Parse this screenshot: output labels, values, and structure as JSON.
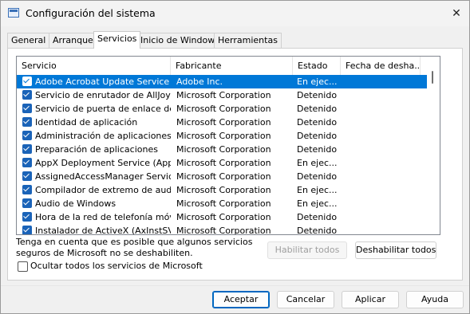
{
  "window": {
    "title": "Configuración del sistema",
    "close_glyph": "✕",
    "icon": "msconfig-icon"
  },
  "tabs": [
    {
      "label": "General"
    },
    {
      "label": "Arranque"
    },
    {
      "label": "Servicios",
      "active": true
    },
    {
      "label": "Inicio de Windows"
    },
    {
      "label": "Herramientas"
    }
  ],
  "services": {
    "columns": [
      "Servicio",
      "Fabricante",
      "Estado",
      "Fecha de desha..."
    ],
    "rows": [
      {
        "name": "Adobe Acrobat Update Service",
        "maker": "Adobe Inc.",
        "status": "En ejec...",
        "checked": true,
        "selected": true
      },
      {
        "name": "Servicio de enrutador de AllJoyn",
        "maker": "Microsoft Corporation",
        "status": "Detenido",
        "checked": true
      },
      {
        "name": "Servicio de puerta de enlace de ...",
        "maker": "Microsoft Corporation",
        "status": "Detenido",
        "checked": true
      },
      {
        "name": "Identidad de aplicación",
        "maker": "Microsoft Corporation",
        "status": "Detenido",
        "checked": true
      },
      {
        "name": "Administración de aplicaciones",
        "maker": "Microsoft Corporation",
        "status": "Detenido",
        "checked": true
      },
      {
        "name": "Preparación de aplicaciones",
        "maker": "Microsoft Corporation",
        "status": "Detenido",
        "checked": true
      },
      {
        "name": "AppX Deployment Service (AppX...",
        "maker": "Microsoft Corporation",
        "status": "En ejec...",
        "checked": true
      },
      {
        "name": "AssignedAccessManager Service",
        "maker": "Microsoft Corporation",
        "status": "Detenido",
        "checked": true
      },
      {
        "name": "Compilador de extremo de audio...",
        "maker": "Microsoft Corporation",
        "status": "En ejec...",
        "checked": true
      },
      {
        "name": "Audio de Windows",
        "maker": "Microsoft Corporation",
        "status": "En ejec...",
        "checked": true
      },
      {
        "name": "Hora de la red de telefonía móvil",
        "maker": "Microsoft Corporation",
        "status": "Detenido",
        "checked": true
      },
      {
        "name": "Instalador de ActiveX (AxInstSV)",
        "maker": "Microsoft Corporation",
        "status": "Detenido",
        "checked": true
      }
    ]
  },
  "note": "Tenga en cuenta que es posible que algunos servicios seguros de Microsoft no se deshabiliten.",
  "buttons": {
    "enable_all": "Habilitar todos",
    "disable_all": "Deshabilitar todos",
    "ok": "Aceptar",
    "cancel": "Cancelar",
    "apply": "Aplicar",
    "help": "Ayuda"
  },
  "hide_ms": {
    "label": "Ocultar todos los servicios de Microsoft",
    "checked": false
  },
  "colors": {
    "selection": "#0078d7",
    "checkbox": "#1a63b8",
    "default_button_border": "#0067c0"
  }
}
